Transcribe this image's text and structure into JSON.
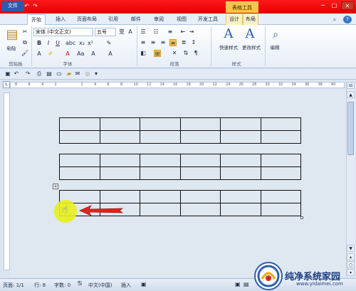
{
  "titlebar": {
    "app_icon": "W",
    "context_title": "表格工具",
    "quick_access_icons": [
      "save-icon",
      "undo-icon",
      "redo-icon"
    ],
    "window_buttons": [
      "─",
      "□",
      "✕"
    ]
  },
  "tabs": [
    {
      "label": "文件"
    },
    {
      "label": "开始"
    },
    {
      "label": "插入"
    },
    {
      "label": "页面布局"
    },
    {
      "label": "引用"
    },
    {
      "label": "邮件"
    },
    {
      "label": "审阅"
    },
    {
      "label": "视图"
    },
    {
      "label": "开发工具"
    },
    {
      "label": "设计"
    },
    {
      "label": "布局"
    }
  ],
  "ribbon": {
    "clipboard": {
      "paste_label": "粘贴",
      "group_label": "剪贴板"
    },
    "font": {
      "font_name": "宋体 (中文正文)",
      "font_size": "五号",
      "group_label": "字体",
      "bold": "B",
      "italic": "I",
      "underline": "U"
    },
    "paragraph": {
      "group_label": "段落"
    },
    "styles": {
      "quick_style_label": "快速样式",
      "change_style_label": "更改样式",
      "group_label": "样式",
      "style_icon_glyph": "A"
    },
    "editing": {
      "edit_label": "编辑"
    }
  },
  "ruler": {
    "ticks": [
      "8",
      "6",
      "4",
      "2",
      "",
      "2",
      "4",
      "6",
      "8",
      "10",
      "12",
      "14",
      "16",
      "18",
      "20",
      "22",
      "24",
      "26",
      "28",
      "30",
      "32",
      "34",
      "36",
      "38",
      "40"
    ]
  },
  "document": {
    "tables": [
      {
        "rows": 2,
        "cols": 6
      },
      {
        "rows": 2,
        "cols": 6
      },
      {
        "rows": 2,
        "cols": 6
      }
    ],
    "table_move_handle": "+"
  },
  "statusbar": {
    "page": "页面: 1/1",
    "line": "行: 8",
    "words": "字数: 0",
    "language": "中文(中国)",
    "mode": "插入"
  },
  "watermark": {
    "text": "纯净系统家园",
    "url": "www.yidaimei.com"
  },
  "colors": {
    "titlebar_red": "#e00000",
    "context_tab_gold": "#f6c44f",
    "highlight_yellow": "#e8ef1a",
    "arrow_red": "#e2231a"
  }
}
